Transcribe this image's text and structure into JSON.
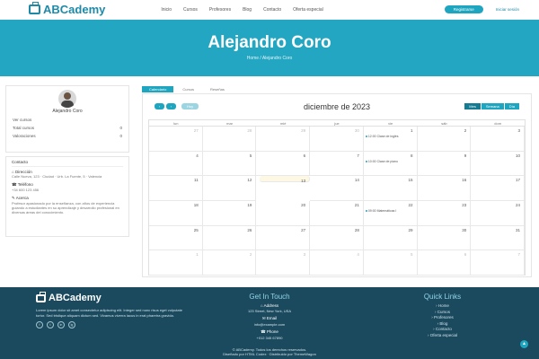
{
  "brand": {
    "name": "ABCademy"
  },
  "nav": {
    "items": [
      "Inicio",
      "Cursos",
      "Profesores",
      "Blog",
      "Contacto",
      "Oferta especial"
    ],
    "register": "Registrarse",
    "login": "Iniciar sesión"
  },
  "hero": {
    "title": "Alejandro Coro",
    "breadcrumb": "Home / Alejandro Coro"
  },
  "profile": {
    "name": "Alejandro Coro",
    "role": "Ver cursos",
    "rows": [
      {
        "label": "Total cursos",
        "value": "0"
      },
      {
        "label": "Valoraciones",
        "value": "0"
      }
    ]
  },
  "contact": {
    "heading": "Contacto",
    "items": [
      {
        "title": "Dirección",
        "value": "Calle Nueva, 123 · Ciudad · Urb. La Fuente, 5 · Valencia"
      },
      {
        "title": "Teléfono",
        "value": "+34 600 123 456"
      },
      {
        "title": "Acerca",
        "value": "Profesor apasionado por la enseñanza, con años de experiencia guiando a estudiantes en su aprendizaje y desarrollo profesional en diversas áreas del conocimiento."
      }
    ]
  },
  "tabs": [
    "Calendario",
    "Cursos",
    "Reseñas"
  ],
  "calendar": {
    "title": "diciembre de 2023",
    "today_label": "Hoy",
    "views": [
      "Mes",
      "Semana",
      "Día"
    ],
    "weekdays": [
      "lun",
      "mar",
      "mié",
      "jue",
      "vie",
      "sáb",
      "dom"
    ],
    "weeks": [
      [
        "27",
        "28",
        "29",
        "30",
        "1",
        "2",
        "3"
      ],
      [
        "4",
        "5",
        "6",
        "7",
        "8",
        "9",
        "10"
      ],
      [
        "11",
        "12",
        "13",
        "14",
        "15",
        "16",
        "17"
      ],
      [
        "18",
        "19",
        "20",
        "21",
        "22",
        "23",
        "24"
      ],
      [
        "25",
        "26",
        "27",
        "28",
        "29",
        "30",
        "31"
      ],
      [
        "1",
        "2",
        "3",
        "4",
        "5",
        "6",
        "7"
      ]
    ],
    "events": [
      {
        "week": 0,
        "day": 4,
        "text": "12:00 Clase de inglés"
      },
      {
        "week": 1,
        "day": 4,
        "text": "10:00 Clase de piano"
      },
      {
        "week": 3,
        "day": 4,
        "text": "09:00 Matemáticas I"
      }
    ]
  },
  "footer": {
    "about": "Lorem ipsum dolor sit amet consectetur adipiscing elit. Integer sed nunc risus eget vulputate tortor. Sed tristique aliquam dictum sed. Vivamus viverra lacus in erat pharetra gravida.",
    "social": [
      "f",
      "t",
      "in",
      "ig"
    ],
    "touch": {
      "heading": "Get In Touch",
      "address_label": "Address",
      "address": "123 Street, New York, USA",
      "email_label": "Email",
      "email": "info@example.com",
      "phone_label": "Phone",
      "phone": "+012 345 67890"
    },
    "quick": {
      "heading": "Quick Links",
      "links": [
        "Home",
        "Cursos",
        "Profesores",
        "Blog",
        "Contacto",
        "Oferta especial"
      ]
    },
    "copyright": "© ABCademy. Todos los derechos reservados.",
    "credits": "Diseñado por HTML Codex · Distribuido por ThemeWagon"
  },
  "colors": {
    "accent": "#1ea5c0",
    "hero": "#23a6c2",
    "footer": "#1b4a5f",
    "today": "#fcf8e3"
  }
}
